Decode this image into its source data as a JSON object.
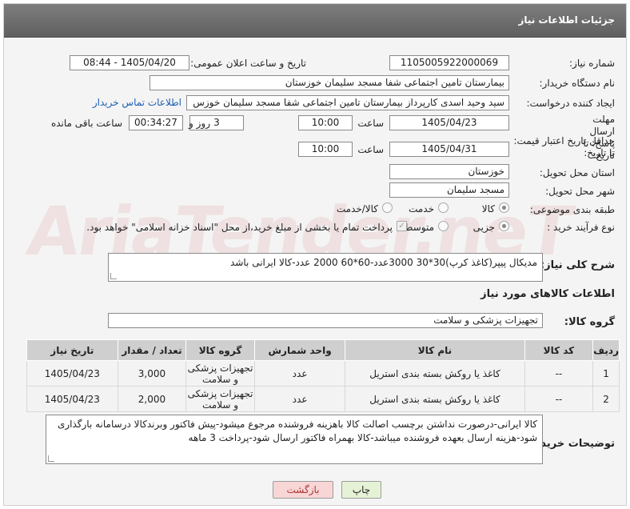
{
  "header": {
    "title": "جزئیات اطلاعات نیاز"
  },
  "form": {
    "need_number_label": "شماره نیاز:",
    "need_number": "1105005922000069",
    "announce_label": "تاریخ و ساعت اعلان عمومی:",
    "announce_value": "1405/04/20 - 08:44",
    "buyer_org_label": "نام دستگاه خریدار:",
    "buyer_org": "بیمارستان تامین اجتماعی شفا مسجد سلیمان خوزستان",
    "creator_label": "ایجاد کننده درخواست:",
    "creator": "سید وحید اسدی کارپرداز بیمارستان تامین اجتماعی شفا مسجد سلیمان خوزس",
    "contact_link": "اطلاعات تماس خریدار",
    "deadline_label": "مهلت ارسال پاسخ: تا تاریخ:",
    "deadline_date": "1405/04/23",
    "time_label": "ساعت",
    "deadline_time": "10:00",
    "days_value": "3",
    "days_label": "روز و",
    "remaining_time": "00:34:27",
    "remaining_label": "ساعت باقی مانده",
    "price_validity_label": "حداقل تاریخ اعتبار قیمت: تا تاریخ:",
    "price_date": "1405/04/31",
    "price_time_label": "ساعت",
    "price_time": "10:00",
    "province_label": "استان محل تحویل:",
    "province": "خوزستان",
    "city_label": "شهر محل تحویل:",
    "city": "مسجد سلیمان",
    "category_label": "طبقه بندی موضوعی:",
    "category_options": [
      "کالا",
      "خدمت",
      "کالا/خدمت"
    ],
    "process_label": "نوع فرآیند خرید :",
    "process_options": [
      "جزیی",
      "متوسط"
    ],
    "payment_note": "پرداخت تمام یا بخشی از مبلغ خرید،از محل \"اسناد خزانه اسلامی\" خواهد بود."
  },
  "description": {
    "label": "شرح کلی نیاز:",
    "text": "مدیکال پیپر(کاغذ کرپ)30*30 3000عدد-60*60  2000 عدد-کالا ایرانی باشد"
  },
  "goods": {
    "section_title": "اطلاعات کالاهای مورد نیاز",
    "group_label": "گروه کالا:",
    "group_value": "تجهیزات پزشکی و سلامت"
  },
  "table": {
    "headers": [
      "ردیف",
      "کد کالا",
      "نام کالا",
      "واحد شمارش",
      "گروه کالا",
      "تعداد / مقدار",
      "تاریخ نیاز"
    ],
    "rows": [
      [
        "1",
        "--",
        "کاغذ یا روکش بسته بندی استریل",
        "عدد",
        "تجهیزات پزشکی و سلامت",
        "3,000",
        "1405/04/23"
      ],
      [
        "2",
        "--",
        "کاغذ یا روکش بسته بندی استریل",
        "عدد",
        "تجهیزات پزشکی و سلامت",
        "2,000",
        "1405/04/23"
      ]
    ]
  },
  "buyer_notes": {
    "label": "توضیحات خریدار:",
    "text": "کالا ایرانی-درصورت نداشتن برچسب اصالت کالا باهزینه فروشنده مرجوع میشود-پیش فاکتور وبرندکالا درسامانه بارگذاری شود-هزینه ارسال بعهده فروشنده میباشد-کالا بهمراه فاکتور ارسال شود-پرداخت 3 ماهه"
  },
  "buttons": {
    "print": "چاپ",
    "back": "بازگشت"
  },
  "watermark": "AriaTender.neT",
  "colors": {
    "header": "#6e6e6e",
    "link": "#1e5fb4",
    "back_button": "#f9d6d6",
    "print_button": "#e6f2d5"
  }
}
